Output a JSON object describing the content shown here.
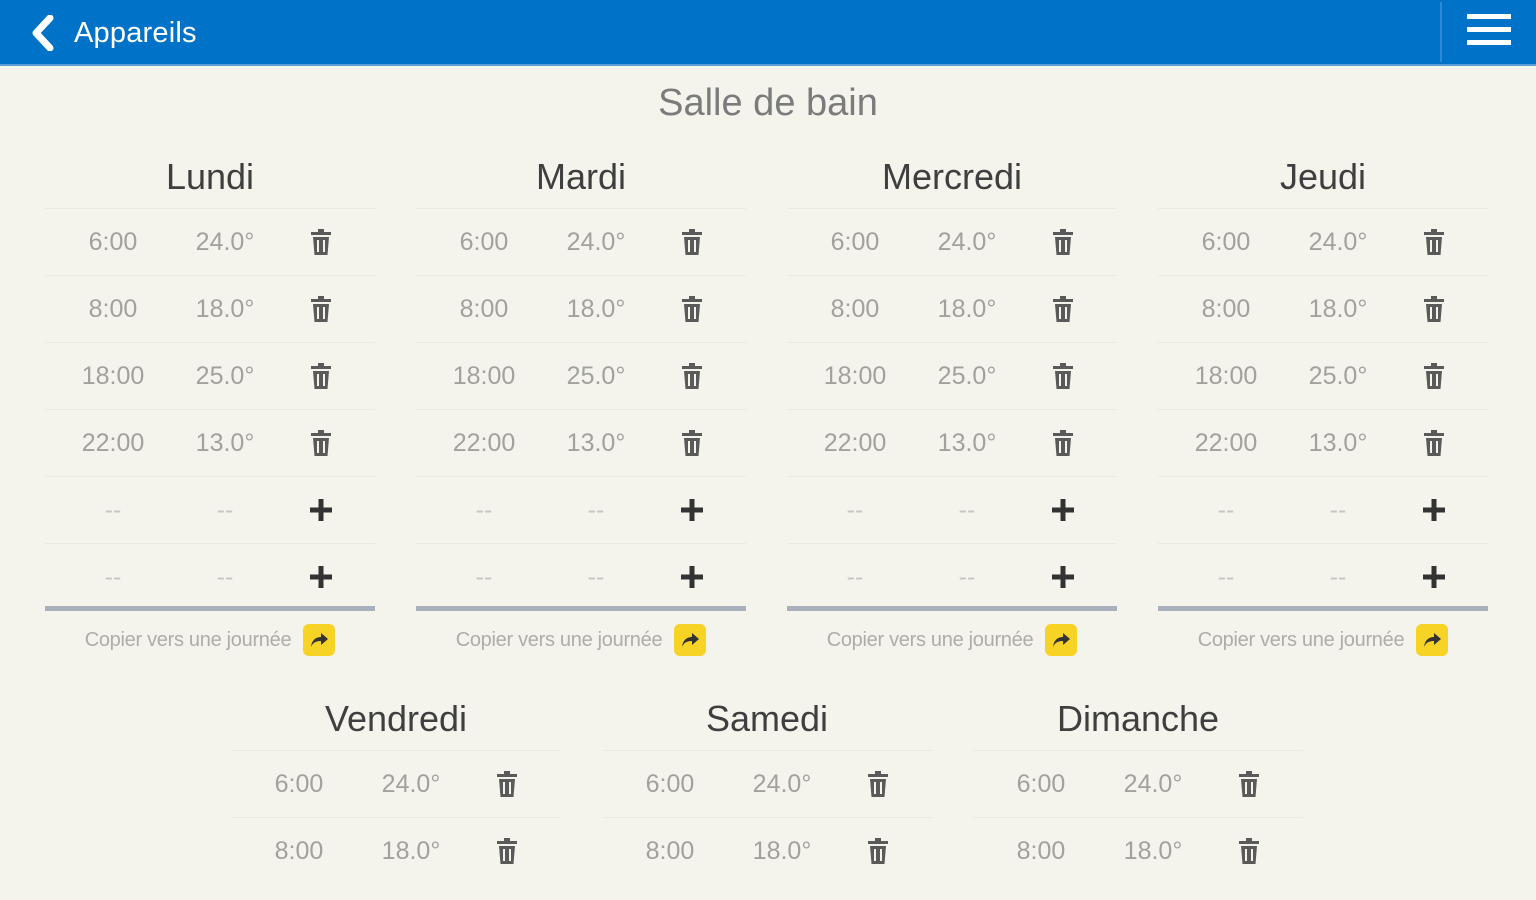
{
  "topbar": {
    "back_label": "Appareils",
    "back_icon": "chevron-left-icon",
    "menu_icon": "hamburger-menu-icon",
    "bg_color": "#0073c8"
  },
  "title": "Salle de bain",
  "copy_label": "Copier vers une journée",
  "accent_color": "#f7d325",
  "days": [
    {
      "name": "Lundi",
      "rows": [
        {
          "time": "6:00",
          "temp": "24.0°",
          "action": "delete"
        },
        {
          "time": "8:00",
          "temp": "18.0°",
          "action": "delete"
        },
        {
          "time": "18:00",
          "temp": "25.0°",
          "action": "delete"
        },
        {
          "time": "22:00",
          "temp": "13.0°",
          "action": "delete"
        },
        {
          "time": "--",
          "temp": "--",
          "action": "add"
        },
        {
          "time": "--",
          "temp": "--",
          "action": "add"
        }
      ]
    },
    {
      "name": "Mardi",
      "rows": [
        {
          "time": "6:00",
          "temp": "24.0°",
          "action": "delete"
        },
        {
          "time": "8:00",
          "temp": "18.0°",
          "action": "delete"
        },
        {
          "time": "18:00",
          "temp": "25.0°",
          "action": "delete"
        },
        {
          "time": "22:00",
          "temp": "13.0°",
          "action": "delete"
        },
        {
          "time": "--",
          "temp": "--",
          "action": "add"
        },
        {
          "time": "--",
          "temp": "--",
          "action": "add"
        }
      ]
    },
    {
      "name": "Mercredi",
      "rows": [
        {
          "time": "6:00",
          "temp": "24.0°",
          "action": "delete"
        },
        {
          "time": "8:00",
          "temp": "18.0°",
          "action": "delete"
        },
        {
          "time": "18:00",
          "temp": "25.0°",
          "action": "delete"
        },
        {
          "time": "22:00",
          "temp": "13.0°",
          "action": "delete"
        },
        {
          "time": "--",
          "temp": "--",
          "action": "add"
        },
        {
          "time": "--",
          "temp": "--",
          "action": "add"
        }
      ]
    },
    {
      "name": "Jeudi",
      "rows": [
        {
          "time": "6:00",
          "temp": "24.0°",
          "action": "delete"
        },
        {
          "time": "8:00",
          "temp": "18.0°",
          "action": "delete"
        },
        {
          "time": "18:00",
          "temp": "25.0°",
          "action": "delete"
        },
        {
          "time": "22:00",
          "temp": "13.0°",
          "action": "delete"
        },
        {
          "time": "--",
          "temp": "--",
          "action": "add"
        },
        {
          "time": "--",
          "temp": "--",
          "action": "add"
        }
      ]
    },
    {
      "name": "Vendredi",
      "rows": [
        {
          "time": "6:00",
          "temp": "24.0°",
          "action": "delete"
        },
        {
          "time": "8:00",
          "temp": "18.0°",
          "action": "delete"
        }
      ]
    },
    {
      "name": "Samedi",
      "rows": [
        {
          "time": "6:00",
          "temp": "24.0°",
          "action": "delete"
        },
        {
          "time": "8:00",
          "temp": "18.0°",
          "action": "delete"
        }
      ]
    },
    {
      "name": "Dimanche",
      "rows": [
        {
          "time": "6:00",
          "temp": "24.0°",
          "action": "delete"
        },
        {
          "time": "8:00",
          "temp": "18.0°",
          "action": "delete"
        }
      ]
    }
  ]
}
